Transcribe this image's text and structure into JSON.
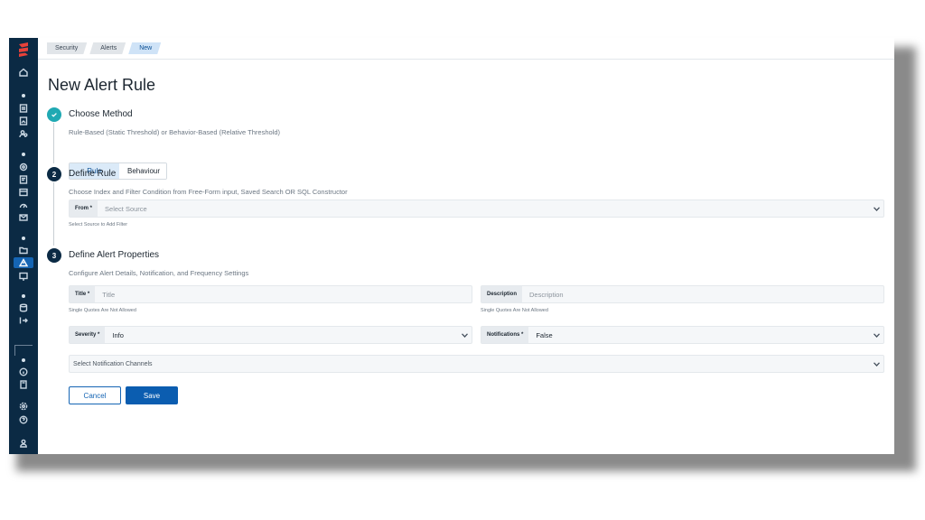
{
  "breadcrumb": [
    "Security",
    "Alerts",
    "New"
  ],
  "page_title": "New Alert Rule",
  "steps": [
    {
      "number": "",
      "title": "Choose Method",
      "description": "Rule-Based (Static Threshold) or Behavior-Based (Relative Threshold)"
    },
    {
      "number": "2",
      "title": "Define Rule",
      "description": "Choose Index and Filter Condition from Free-Form input, Saved Search OR SQL Constructor"
    },
    {
      "number": "3",
      "title": "Define Alert Properties",
      "description": "Configure Alert Details, Notification, and Frequency Settings"
    }
  ],
  "method_toggle": {
    "options": [
      "Rule",
      "Behaviour"
    ],
    "selected": "Rule"
  },
  "from_field": {
    "label": "From *",
    "placeholder": "Select Source",
    "hint": "Select Source to Add Filter"
  },
  "title_field": {
    "label": "Title *",
    "placeholder": "Title",
    "hint": "Single Quotes Are Not Allowed"
  },
  "description_field": {
    "label": "Description",
    "placeholder": "Description",
    "hint": "Single Quotes Are Not Allowed"
  },
  "severity_field": {
    "label": "Severity *",
    "value": "Info"
  },
  "notifications_field": {
    "label": "Notifications *",
    "value": "False"
  },
  "channels_field": {
    "placeholder": "Select Notification Channels"
  },
  "buttons": {
    "cancel": "Cancel",
    "save": "Save"
  },
  "colors": {
    "sidebar": "#0b2a44",
    "accent": "#1565b4",
    "step_done": "#20a9b3",
    "logo": "#e8423a"
  },
  "sidebar_icons": [
    "home-icon",
    "discover-icon",
    "reports-icon",
    "users-icon",
    "settings-icon",
    "notes-icon",
    "dashboard-icon",
    "gauge-icon",
    "mail-icon",
    "folder-icon",
    "alert-icon",
    "monitor-icon",
    "database-icon",
    "export-icon",
    "info-icon",
    "book-icon",
    "gear-icon",
    "help-icon",
    "user-icon"
  ]
}
